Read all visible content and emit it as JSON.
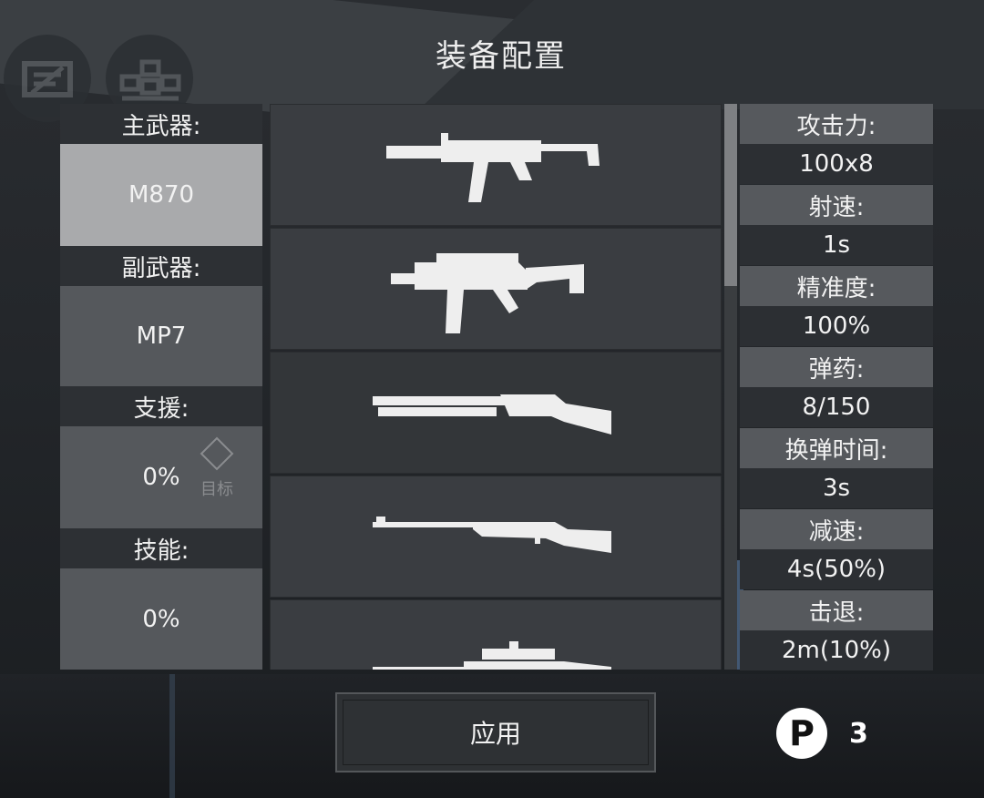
{
  "header": {
    "title": "装备配置"
  },
  "hud": {
    "left_icon": "chat-icon",
    "right_icon": "map-icon"
  },
  "loadout": {
    "primary": {
      "label": "主武器:",
      "value": "M870",
      "active": true
    },
    "secondary": {
      "label": "副武器:",
      "value": "MP7"
    },
    "support": {
      "label": "支援:",
      "value": "0%",
      "target_label": "目标",
      "target_icon": "diamond-icon"
    },
    "skill": {
      "label": "技能:",
      "value": "0%"
    }
  },
  "weapons": [
    {
      "icon": "smg-suppressed-icon"
    },
    {
      "icon": "smg-folding-stock-icon"
    },
    {
      "icon": "shotgun-icon"
    },
    {
      "icon": "bolt-action-rifle-icon"
    },
    {
      "icon": "sniper-rifle-icon"
    }
  ],
  "stats": [
    {
      "label": "攻击力:",
      "value": "100x8"
    },
    {
      "label": "射速:",
      "value": "1s"
    },
    {
      "label": "精准度:",
      "value": "100%"
    },
    {
      "label": "弹药:",
      "value": "8/150"
    },
    {
      "label": "换弹时间:",
      "value": "3s"
    },
    {
      "label": "减速:",
      "value": "4s(50%)"
    },
    {
      "label": "击退:",
      "value": "2m(10%)"
    }
  ],
  "actions": {
    "apply_label": "应用"
  },
  "points": {
    "icon": "points-icon",
    "symbol": "P",
    "count": "3"
  },
  "colors": {
    "panel_light": "#a9aaac",
    "panel_mid": "#55585c",
    "panel_dark": "#2d3034",
    "text": "#f2f2f2"
  }
}
